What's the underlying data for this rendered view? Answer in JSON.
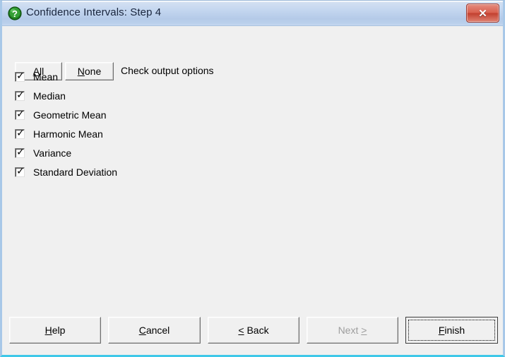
{
  "window": {
    "title": "Confidence Intervals: Step 4",
    "icon": "green-question-help-icon",
    "close_label": "✕",
    "accent_titlebar": "#b4cae8",
    "accent_close": "#d9604f",
    "accent_border": "#3ec8e8",
    "background": "#f0f0f0"
  },
  "toolbar": {
    "all_label": "All",
    "all_accel": "A",
    "none_label": "None",
    "none_accel": "N",
    "hint": "Check output options"
  },
  "options": [
    {
      "label": "Mean",
      "checked": true
    },
    {
      "label": "Median",
      "checked": true
    },
    {
      "label": "Geometric Mean",
      "checked": true
    },
    {
      "label": "Harmonic Mean",
      "checked": true
    },
    {
      "label": "Variance",
      "checked": true
    },
    {
      "label": "Standard Deviation",
      "checked": true
    }
  ],
  "footer": {
    "help_label": "Help",
    "help_accel": "H",
    "cancel_label": "Cancel",
    "cancel_accel": "C",
    "back_label": "< Back",
    "back_accel": "<",
    "next_label": "Next >",
    "next_accel": ">",
    "next_disabled": true,
    "finish_label": "Finish",
    "finish_accel": "F",
    "finish_default": true
  }
}
